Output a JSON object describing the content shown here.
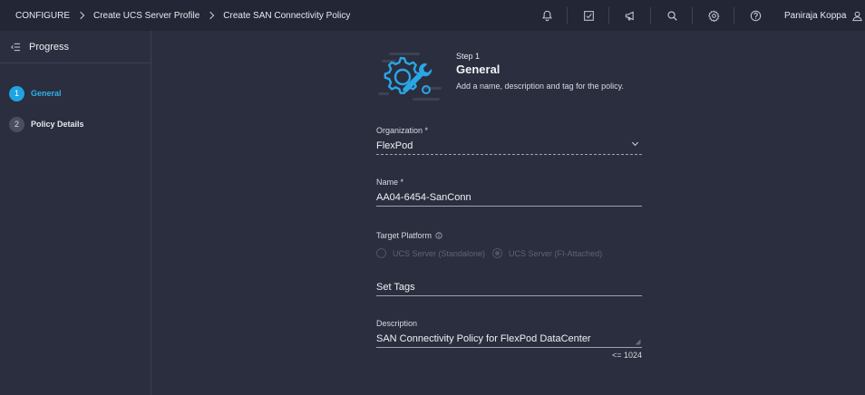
{
  "breadcrumbs": [
    "CONFIGURE",
    "Create UCS Server Profile",
    "Create SAN Connectivity Policy"
  ],
  "topbar": {
    "icons": [
      "bell-icon",
      "task-check-icon",
      "megaphone-icon",
      "search-icon",
      "gear-icon",
      "help-icon"
    ],
    "user_name": "Paniraja Koppa"
  },
  "sidebar": {
    "title": "Progress",
    "steps": [
      {
        "number": "1",
        "label": "General",
        "state": "active"
      },
      {
        "number": "2",
        "label": "Policy Details",
        "state": "todo"
      }
    ]
  },
  "header": {
    "kicker": "Step 1",
    "title": "General",
    "subtitle": "Add a name, description and tag for the policy."
  },
  "form": {
    "organization": {
      "label": "Organization *",
      "value": "FlexPod"
    },
    "name": {
      "label": "Name *",
      "value": "AA04-6454-SanConn"
    },
    "target_platform": {
      "label": "Target Platform",
      "options": [
        "UCS Server (Standalone)",
        "UCS Server (FI-Attached)"
      ],
      "selected": "UCS Server (FI-Attached)"
    },
    "tags": {
      "placeholder": "Set Tags"
    },
    "description": {
      "label": "Description",
      "value": "SAN Connectivity Policy for FlexPod DataCenter",
      "counter": "<= 1024"
    }
  },
  "colors": {
    "background": "#2a2e3e",
    "topbar": "#232635",
    "accent": "#1fa3e3",
    "icon_blue": "#2aa6e6"
  }
}
